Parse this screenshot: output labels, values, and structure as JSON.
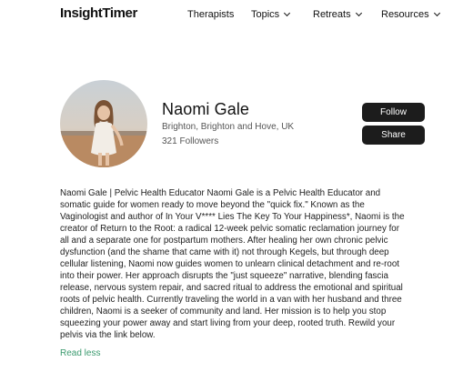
{
  "nav": {
    "logo": "InsightTimer",
    "items": [
      {
        "label": "Therapists",
        "has_dropdown": false
      },
      {
        "label": "Topics",
        "has_dropdown": true
      },
      {
        "label": "Retreats",
        "has_dropdown": true
      },
      {
        "label": "Resources",
        "has_dropdown": true
      }
    ]
  },
  "profile": {
    "name": "Naomi Gale",
    "location": "Brighton, Brighton and Hove, UK",
    "followers": "321 Followers",
    "follow_label": "Follow",
    "share_label": "Share"
  },
  "bio": {
    "lines": [
      "Naomi Gale | Pelvic Health Educator Naomi Gale is a Pelvic Health Educator and",
      "somatic guide for women ready to move beyond the \"quick fix.\" Known as the",
      "Vaginologist and author of In Your V**** Lies The Key To Your Happiness*, Naomi is the",
      "creator of Return to the Root: a radical 12-week pelvic somatic reclamation journey for",
      "all and a separate one for postpartum mothers. After healing her own chronic pelvic",
      "dysfunction (and the shame that came with it) not through Kegels, but through deep",
      "cellular listening, Naomi now guides women to unlearn clinical detachment and re-root",
      "into their power. Her approach disrupts the \"just squeeze\" narrative, blending fascia",
      "release, nervous system repair, and sacred ritual to address the emotional and spiritual",
      "roots of pelvic health. Currently traveling the world in a van with her husband and three",
      "children, Naomi is a seeker of community and land. Her mission is to help you stop",
      "squeezing your power away and start living from your deep, rooted truth. Rewild your",
      "pelvis via the link below."
    ],
    "toggle_label": "Read less"
  },
  "colors": {
    "button_bg": "#1c1c1c",
    "link": "#3a9a6e"
  }
}
